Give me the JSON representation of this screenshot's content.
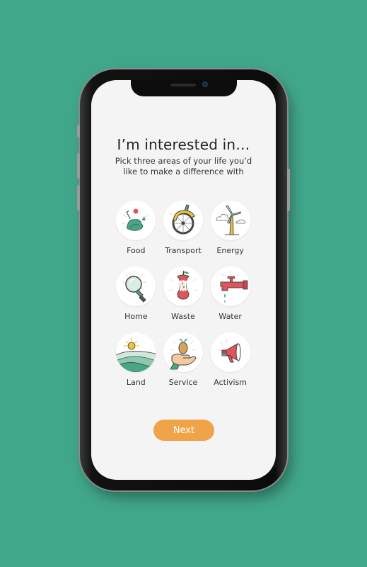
{
  "header": {
    "title": "I’m interested in…",
    "subtitle": "Pick three areas of your life you’d like to make a difference with"
  },
  "interests": [
    {
      "label": "Food",
      "icon": "vegetables-icon"
    },
    {
      "label": "Transport",
      "icon": "bicycle-wheel-icon"
    },
    {
      "label": "Energy",
      "icon": "wind-turbine-icon"
    },
    {
      "label": "Home",
      "icon": "light-bulb-icon"
    },
    {
      "label": "Waste",
      "icon": "apple-core-icon"
    },
    {
      "label": "Water",
      "icon": "water-tap-icon"
    },
    {
      "label": "Land",
      "icon": "hills-sun-icon"
    },
    {
      "label": "Service",
      "icon": "hand-holding-seed-icon"
    },
    {
      "label": "Activism",
      "icon": "megaphone-icon"
    }
  ],
  "actions": {
    "next_label": "Next"
  },
  "colors": {
    "background": "#41a78a",
    "screen": "#f4f4f4",
    "accent_button": "#f0a44a",
    "icon_green": "#4aa582",
    "icon_red": "#e0555b",
    "icon_yellow": "#f2c23d"
  }
}
